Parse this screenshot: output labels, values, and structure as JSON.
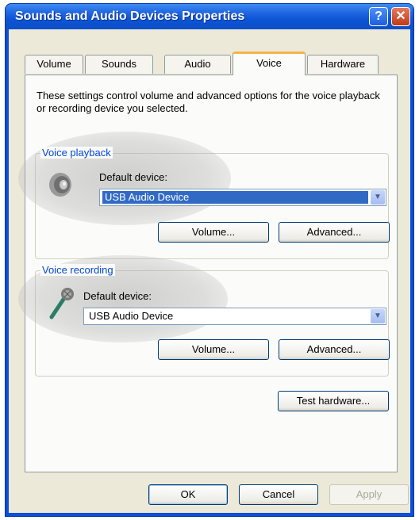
{
  "window": {
    "title": "Sounds and Audio Devices Properties"
  },
  "tabs": [
    {
      "label": "Volume",
      "active": false
    },
    {
      "label": "Sounds",
      "active": false
    },
    {
      "label": "Audio",
      "active": false
    },
    {
      "label": "Voice",
      "active": true
    },
    {
      "label": "Hardware",
      "active": false
    }
  ],
  "description": "These settings control volume and advanced options for the voice playback or recording device you selected.",
  "playback": {
    "legend": "Voice playback",
    "device_label": "Default device:",
    "device_value": "USB Audio Device",
    "volume_button": "Volume...",
    "advanced_button": "Advanced..."
  },
  "recording": {
    "legend": "Voice recording",
    "device_label": "Default device:",
    "device_value": "USB Audio Device",
    "volume_button": "Volume...",
    "advanced_button": "Advanced..."
  },
  "test_hardware_button": "Test hardware...",
  "footer": {
    "ok": "OK",
    "cancel": "Cancel",
    "apply": "Apply"
  },
  "icons": {
    "help": "help-icon",
    "close": "close-icon",
    "speaker": "speaker-icon",
    "microphone": "microphone-icon",
    "dropdown": "chevron-down-icon"
  },
  "colors": {
    "titlebar": "#0c55d6",
    "legend_text": "#0046d5",
    "selection": "#316ac5",
    "active_tab_accent": "#f5b445"
  }
}
